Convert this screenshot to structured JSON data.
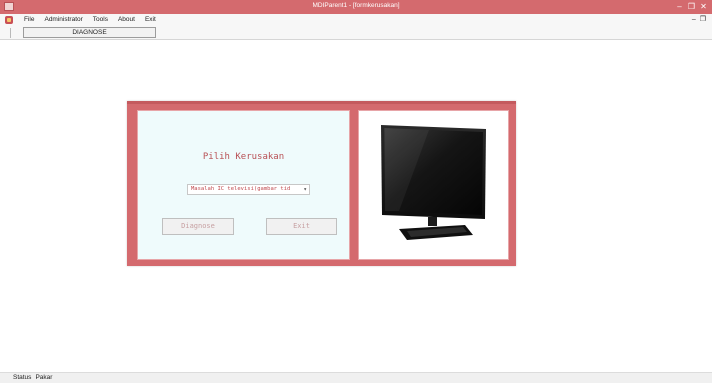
{
  "window": {
    "title": "MDIParent1 - [formkerusakan]",
    "minimize_glyph": "–",
    "maximize_glyph": "❐",
    "close_glyph": "✕"
  },
  "menu": {
    "items": [
      "File",
      "Administrator",
      "Tools",
      "About",
      "Exit"
    ],
    "mdi_controls": [
      "–",
      "❐"
    ]
  },
  "toolbar": {
    "diagnose_label": "DIAGNOSE"
  },
  "form": {
    "heading": "Pilih Kerusakan",
    "combo_value": "Masalah IC televisi(gambar tid",
    "diagnose_button": "Diagnose",
    "exit_button": "Exit",
    "image": "tv-monitor-photo"
  },
  "status": {
    "label": "Status",
    "value": "Pakar"
  },
  "colors": {
    "title_bar": "#d46a6e",
    "form_border": "#d46a6e",
    "panel_bg": "#effbfc",
    "accent_text": "#b85055"
  }
}
